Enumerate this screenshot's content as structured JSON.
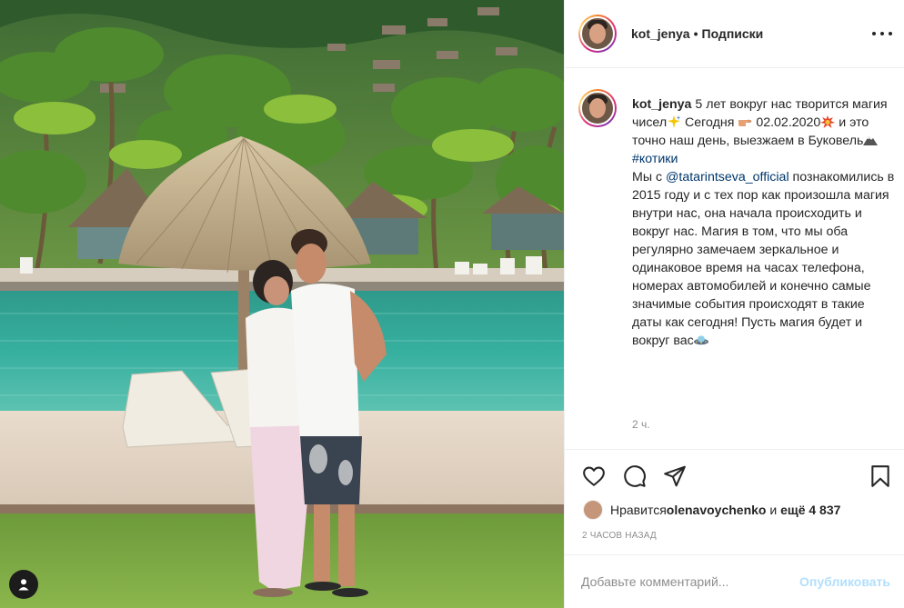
{
  "post": {
    "username": "kot_jenya",
    "separator": "•",
    "follow_label": "Подписки",
    "more_icon": "more-horizontal-icon"
  },
  "caption": {
    "author": "kot_jenya",
    "line1": " 5 лет вокруг нас творится магия чисел",
    "line2": " Сегодня ",
    "line3": " 02.02.2020",
    "line4": " и это точно наш день, выезжаем в Буковель",
    "hashtag": "#котики",
    "line5": "Мы с ",
    "mention": "@tatarintseva_official",
    "line6": " познакомились в 2015 году и с тех пор как произошла магия внутри нас, она начала происходить и вокруг нас. Магия в том, что мы оба регулярно замечаем зеркальное и одинаковое время на часах телефона, номерах автомобилей и конечно самые значимые события происходят в такие даты как сегодня! Пусть магия будет и вокруг вас",
    "time": "2 ч."
  },
  "likes": {
    "prefix": "Нравится ",
    "user": "olenavoychenko",
    "middle": " и ",
    "count": "ещё 4 837"
  },
  "date_label": "2 ЧАСОВ НАЗАД",
  "comment": {
    "placeholder": "Добавьте комментарий...",
    "publish_label": "Опубликовать"
  },
  "colors": {
    "link": "#00376b",
    "muted": "#8e8e8e",
    "publish_disabled": "#b2dffc"
  }
}
